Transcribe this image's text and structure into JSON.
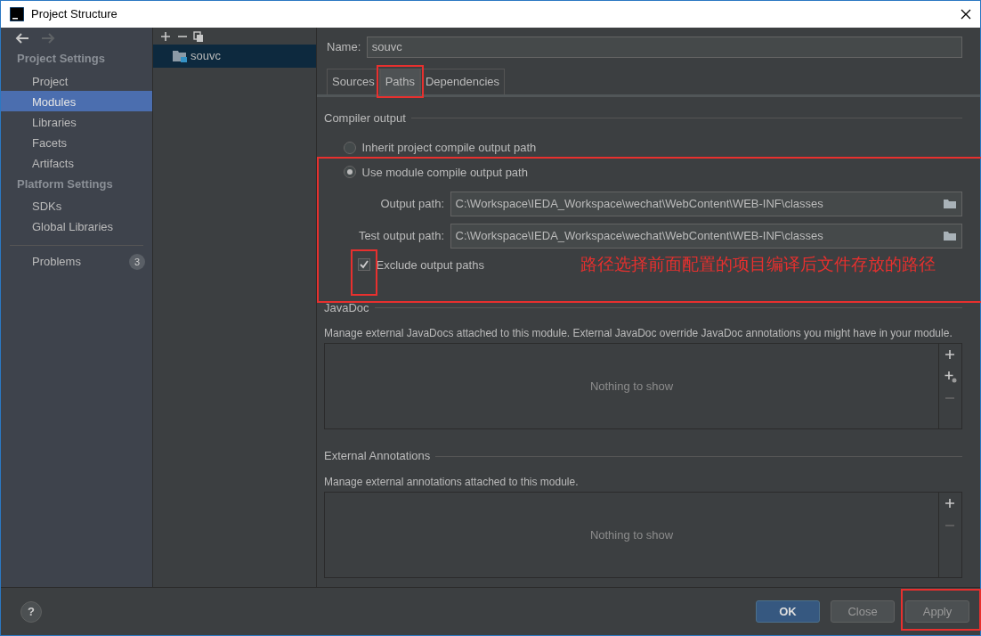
{
  "window": {
    "title": "Project Structure"
  },
  "sidebar": {
    "sections": [
      {
        "title": "Project Settings",
        "items": [
          {
            "label": "Project",
            "selected": false
          },
          {
            "label": "Modules",
            "selected": true
          },
          {
            "label": "Libraries",
            "selected": false
          },
          {
            "label": "Facets",
            "selected": false
          },
          {
            "label": "Artifacts",
            "selected": false
          }
        ]
      },
      {
        "title": "Platform Settings",
        "items": [
          {
            "label": "SDKs",
            "selected": false
          },
          {
            "label": "Global Libraries",
            "selected": false
          }
        ]
      }
    ],
    "problems": {
      "label": "Problems",
      "count": "3"
    }
  },
  "modules": [
    {
      "label": "souvc",
      "selected": true
    }
  ],
  "name_field": {
    "label": "Name:",
    "value": "souvc"
  },
  "tabs": [
    {
      "label": "Sources",
      "selected": false,
      "highlighted": false
    },
    {
      "label": "Paths",
      "selected": true,
      "highlighted": true
    },
    {
      "label": "Dependencies",
      "selected": false,
      "highlighted": false
    }
  ],
  "compiler_output": {
    "title": "Compiler output",
    "options": [
      {
        "label": "Inherit project compile output path",
        "selected": false
      },
      {
        "label": "Use module compile output path",
        "selected": true
      }
    ],
    "group_highlighted": true,
    "paths": [
      {
        "label": "Output path:",
        "value": "C:\\Workspace\\IEDA_Workspace\\wechat\\WebContent\\WEB-INF\\classes"
      },
      {
        "label": "Test output path:",
        "value": "C:\\Workspace\\IEDA_Workspace\\wechat\\WebContent\\WEB-INF\\classes"
      }
    ],
    "exclude": {
      "label": "Exclude output paths",
      "checked": true,
      "highlighted": true
    },
    "note": "路径选择前面配置的项目编译后文件存放的路径"
  },
  "javadoc": {
    "title": "JavaDoc",
    "description": "Manage external JavaDocs attached to this module. External JavaDoc override JavaDoc annotations you might have in your module.",
    "empty_text": "Nothing to show"
  },
  "external_annotations": {
    "title": "External Annotations",
    "description": "Manage external annotations attached to this module.",
    "empty_text": "Nothing to show"
  },
  "footer": {
    "help": "?",
    "buttons": [
      {
        "label": "OK",
        "kind": "primary",
        "highlighted": false
      },
      {
        "label": "Close",
        "kind": "default",
        "highlighted": false
      },
      {
        "label": "Apply",
        "kind": "default",
        "highlighted": true
      }
    ]
  }
}
